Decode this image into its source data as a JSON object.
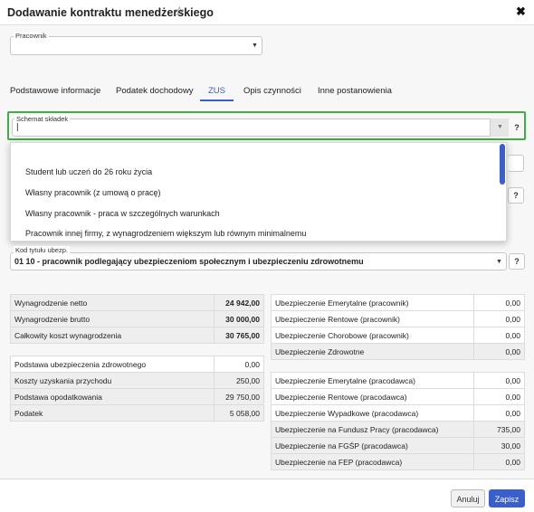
{
  "dialog": {
    "title": "Dodawanie kontraktu menedżerskiego",
    "star_icon": "☆",
    "close_icon": "✖"
  },
  "pracownik": {
    "label": "Pracownik",
    "value": ""
  },
  "tabs": [
    {
      "label": "Podstawowe informacje"
    },
    {
      "label": "Podatek dochodowy"
    },
    {
      "label": "ZUS"
    },
    {
      "label": "Opis czynności"
    },
    {
      "label": "Inne postanowienia"
    }
  ],
  "schemat": {
    "label": "Schemat składek",
    "value": "|",
    "help": "?",
    "options": [
      "Student lub uczeń do 26 roku życia",
      "Własny pracownik (z umową o pracę)",
      "Własny pracownik - praca w szczególnych warunkach",
      "Pracownik innej firmy, z wynagrodzeniem większym lub równym minimalnemu"
    ]
  },
  "kod_tytulu": {
    "label": "Kod tytułu ubezp.",
    "value": "01 10 - pracownik podlegający ubezpieczeniom społecznym i ubezpieczeniu zdrowotnemu",
    "help": "?"
  },
  "hidden_help": "?",
  "left_table_1": [
    {
      "label": "Wynagrodzenie netto",
      "value": "24 942,00"
    },
    {
      "label": "Wynagrodzenie brutto",
      "value": "30 000,00"
    },
    {
      "label": "Całkowity koszt wynagrodzenia",
      "value": "30 765,00"
    }
  ],
  "left_table_2": [
    {
      "label": "Podstawa ubezpieczenia zdrowotnego",
      "value": "0,00"
    },
    {
      "label": "Koszty uzyskania przychodu",
      "value": "250,00"
    },
    {
      "label": "Podstawa opodatkowania",
      "value": "29 750,00"
    },
    {
      "label": "Podatek",
      "value": "5 058,00"
    }
  ],
  "right_table_1": [
    {
      "label": "Ubezpieczenie Emerytalne (pracownik)",
      "value": "0,00"
    },
    {
      "label": "Ubezpieczenie Rentowe (pracownik)",
      "value": "0,00"
    },
    {
      "label": "Ubezpieczenie Chorobowe (pracownik)",
      "value": "0,00"
    },
    {
      "label": "Ubezpieczenie Zdrowotne",
      "value": "0,00"
    }
  ],
  "right_table_2": [
    {
      "label": "Ubezpieczenie Emerytalne (pracodawca)",
      "value": "0,00"
    },
    {
      "label": "Ubezpieczenie Rentowe (pracodawca)",
      "value": "0,00"
    },
    {
      "label": "Ubezpieczenie Wypadkowe (pracodawca)",
      "value": "0,00"
    },
    {
      "label": "Ubezpieczenie na Fundusz Pracy (pracodawca)",
      "value": "735,00"
    },
    {
      "label": "Ubezpieczenie na FGŚP (pracodawca)",
      "value": "30,00"
    },
    {
      "label": "Ubezpieczenie na FEP (pracodawca)",
      "value": "0,00"
    }
  ],
  "footer": {
    "cancel": "Anuluj",
    "save": "Zapisz"
  },
  "colors": {
    "accent": "#3a5fcd",
    "focus": "#3cb043"
  }
}
